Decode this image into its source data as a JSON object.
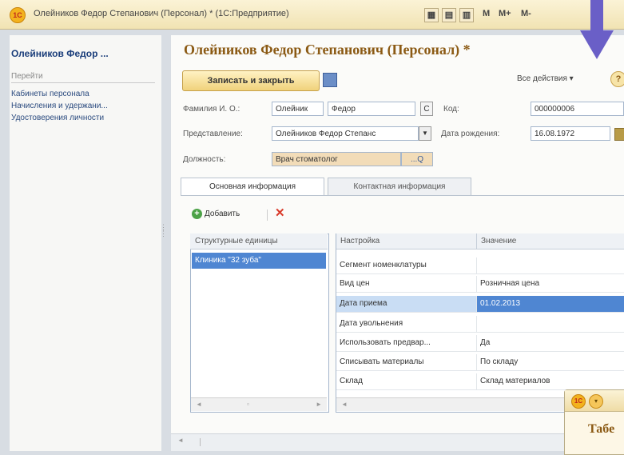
{
  "window": {
    "app_logo": "1С",
    "title": "Олейников Федор Степанович (Персонал) * (1С:Предприятие)",
    "toolbar_icons": [
      "calculator-icon",
      "calendar-icon",
      "chart-icon"
    ],
    "memory_buttons": [
      "M",
      "M+",
      "M-"
    ]
  },
  "sidebar": {
    "title": "Олейников Федор ...",
    "nav_label": "Перейти",
    "items": [
      {
        "label": "Кабинеты персонала"
      },
      {
        "label": "Начисления и удержани..."
      },
      {
        "label": "Удостоверения личности"
      }
    ]
  },
  "form": {
    "title": "Олейников Федор Степанович (Персонал) *",
    "save_label": "Записать и закрыть",
    "all_actions_label": "Все действия ▾",
    "help_label": "?",
    "fio_label": "Фамилия И. О.:",
    "last_name": "Олейник",
    "first_name": "Федор",
    "c_button": "С",
    "code_label": "Код:",
    "code_value": "000000006",
    "representation_label": "Представление:",
    "representation_value": "Олейников Федор Степанс",
    "birth_label": "Дата рождения:",
    "birth_value": "16.08.1972",
    "position_label": "Должность:",
    "position_value": "Врач стоматолог",
    "position_buttons": "...Q"
  },
  "tabs": [
    {
      "label": "Основная информация",
      "active": true
    },
    {
      "label": "Контактная информация",
      "active": false
    }
  ],
  "toolbar": {
    "add_label": "Добавить",
    "delete_icon": "✕"
  },
  "units_table": {
    "header": "Структурные единицы",
    "rows": [
      "Клиника \"32 зуба\""
    ]
  },
  "settings_table": {
    "headers": [
      "Настройка",
      "Значение"
    ],
    "rows": [
      {
        "setting": "Сегмент номенклатуры",
        "value": ""
      },
      {
        "setting": "Вид цен",
        "value": "Розничная цена"
      },
      {
        "setting": "Дата приема",
        "value": "01.02.2013",
        "selected": true
      },
      {
        "setting": "Дата увольнения",
        "value": ""
      },
      {
        "setting": "Использовать предвар...",
        "value": "Да"
      },
      {
        "setting": "Списывать материалы",
        "value": "По складу"
      },
      {
        "setting": "Склад",
        "value": "Склад материалов"
      }
    ]
  },
  "overlay": {
    "title": "Табе"
  },
  "colors": {
    "accent_title": "#8b5a14",
    "selection": "#4f86d2",
    "arrow": "#6a5fc7"
  }
}
